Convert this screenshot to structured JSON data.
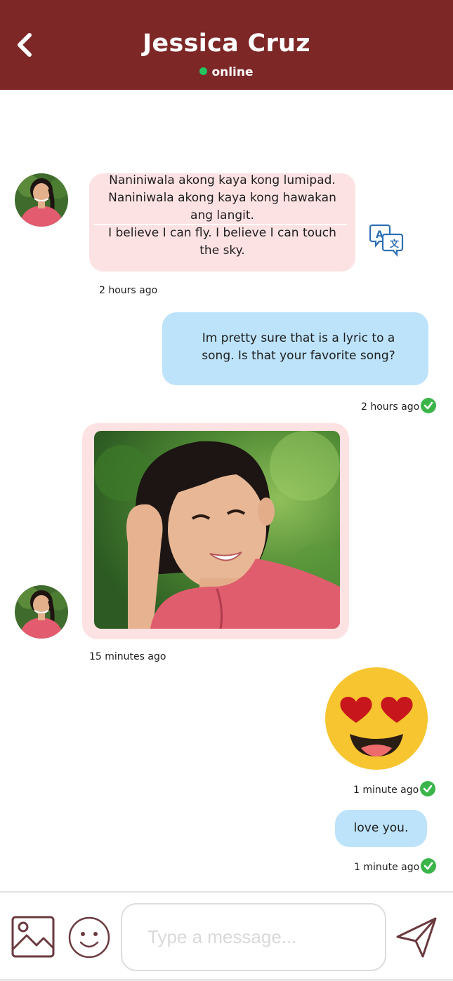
{
  "header": {
    "contact_name": "Jessica Cruz",
    "status": "online",
    "status_color": "#22c55e",
    "background": "#7d2727"
  },
  "messages": [
    {
      "direction": "incoming",
      "type": "text",
      "original_text": "Naniniwala akong kaya kong lumipad. Naniniwala akong kaya kong hawakan ang langit.",
      "translated_text": "I believe I can fly. I believe I can touch the sky.",
      "time": "2 hours ago"
    },
    {
      "direction": "outgoing",
      "type": "text",
      "text": "Im pretty sure that is a lyric to a song. Is that your favorite song?",
      "time": "2 hours ago",
      "read": true
    },
    {
      "direction": "incoming",
      "type": "image",
      "image": "photo-of-woman-smiling",
      "time": "15 minutes ago"
    },
    {
      "direction": "outgoing",
      "type": "emoji",
      "emoji": "heart-eyes-emoji",
      "time": "1 minute ago",
      "read": true
    },
    {
      "direction": "outgoing",
      "type": "text",
      "text": "love you.",
      "time": "1 minute ago",
      "read": true
    }
  ],
  "composer": {
    "placeholder": "Type a message...",
    "value": ""
  },
  "colors": {
    "incoming_bubble": "#fde2e4",
    "outgoing_bubble": "#bde3fa",
    "read_check": "#3bb54a",
    "icon_stroke": "#6b3a3f"
  }
}
